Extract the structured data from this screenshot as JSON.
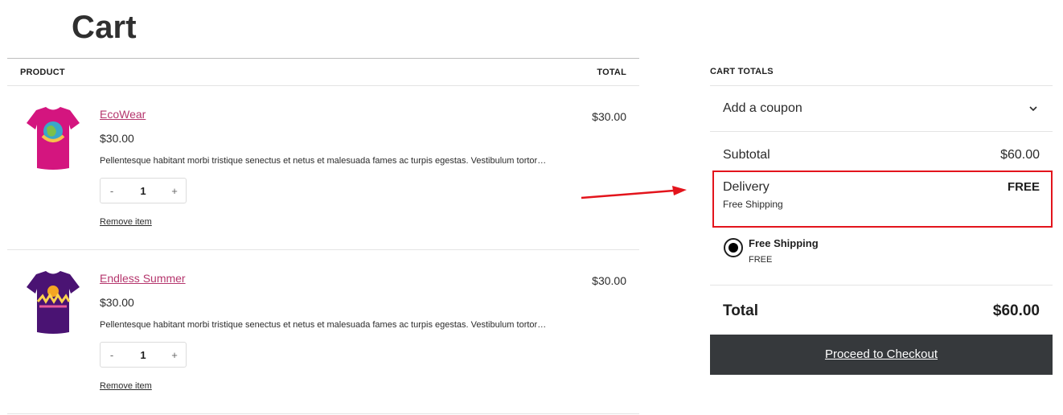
{
  "page": {
    "title": "Cart"
  },
  "cart": {
    "headers": {
      "product": "PRODUCT",
      "total": "TOTAL"
    },
    "items": [
      {
        "name": "EcoWear",
        "price": "$30.00",
        "description": "Pellentesque habitant morbi tristique senectus et netus et malesuada fames ac turpis egestas. Vestibulum tortor…",
        "quantity": "1",
        "qty_minus": "-",
        "qty_plus": "+",
        "remove": "Remove item",
        "total": "$30.00",
        "image_icon": "tshirt-icon",
        "color": "#d4157f"
      },
      {
        "name": "Endless Summer",
        "price": "$30.00",
        "description": "Pellentesque habitant morbi tristique senectus et netus et malesuada fames ac turpis egestas. Vestibulum tortor…",
        "quantity": "1",
        "qty_minus": "-",
        "qty_plus": "+",
        "remove": "Remove item",
        "total": "$30.00",
        "image_icon": "tshirt-icon",
        "color": "#4a1373"
      }
    ]
  },
  "totals": {
    "heading": "CART TOTALS",
    "coupon": "Add a coupon",
    "subtotal_label": "Subtotal",
    "subtotal_value": "$60.00",
    "delivery_label": "Delivery",
    "delivery_value": "FREE",
    "delivery_method": "Free Shipping",
    "shipping_option_name": "Free Shipping",
    "shipping_option_price": "FREE",
    "total_label": "Total",
    "total_value": "$60.00",
    "checkout_label": "Proceed to Checkout"
  },
  "colors": {
    "link": "#b5366d",
    "annotation": "#e3141c",
    "checkout_bg": "#36393c"
  }
}
